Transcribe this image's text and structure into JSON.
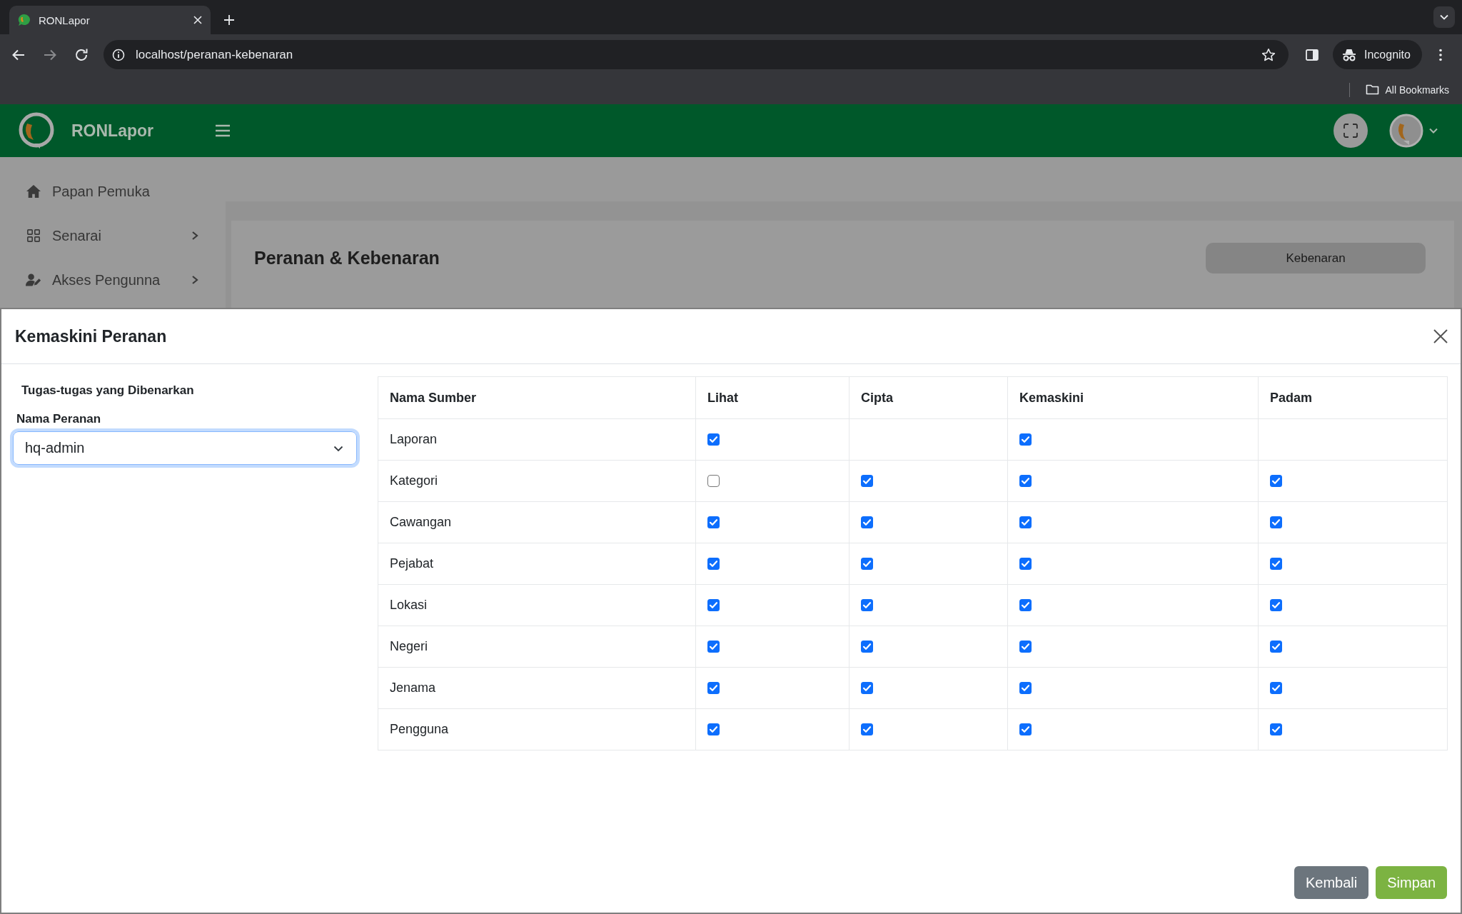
{
  "browser": {
    "tab": {
      "title": "RONLapor"
    },
    "url": "localhost/peranan-kebenaran",
    "profile": {
      "label": "Incognito"
    },
    "bookmarks": [
      "All Bookmarks"
    ]
  },
  "app_header": {
    "brand": "RONLapor"
  },
  "sidebar": {
    "items": [
      {
        "label": "Papan Pemuka",
        "has_submenu": false
      },
      {
        "label": "Senarai",
        "has_submenu": true
      },
      {
        "label": "Akses Pengunna",
        "has_submenu": true
      }
    ]
  },
  "page": {
    "title": "Peranan & Kebenaran",
    "button": "Kebenaran"
  },
  "modal": {
    "title": "Kemaskini Peranan",
    "section_title": "Tugas-tugas yang Dibenarkan",
    "role_field": {
      "label": "Nama Peranan",
      "value": "hq-admin",
      "focused": true
    },
    "table": {
      "columns": [
        "Nama Sumber",
        "Lihat",
        "Cipta",
        "Kemaskini",
        "Padam"
      ],
      "rows": [
        {
          "name": "Laporan",
          "cells": [
            {
              "kind": "checkbox",
              "checked": true
            },
            {
              "kind": "blank"
            },
            {
              "kind": "checkbox",
              "checked": true
            },
            {
              "kind": "blank"
            }
          ]
        },
        {
          "name": "Kategori",
          "cells": [
            {
              "kind": "checkbox",
              "checked": false
            },
            {
              "kind": "checkbox",
              "checked": true
            },
            {
              "kind": "checkbox",
              "checked": true
            },
            {
              "kind": "checkbox",
              "checked": true
            }
          ]
        },
        {
          "name": "Cawangan",
          "cells": [
            {
              "kind": "checkbox",
              "checked": true
            },
            {
              "kind": "checkbox",
              "checked": true
            },
            {
              "kind": "checkbox",
              "checked": true
            },
            {
              "kind": "checkbox",
              "checked": true
            }
          ]
        },
        {
          "name": "Pejabat",
          "cells": [
            {
              "kind": "checkbox",
              "checked": true
            },
            {
              "kind": "checkbox",
              "checked": true
            },
            {
              "kind": "checkbox",
              "checked": true
            },
            {
              "kind": "checkbox",
              "checked": true
            }
          ]
        },
        {
          "name": "Lokasi",
          "cells": [
            {
              "kind": "checkbox",
              "checked": true
            },
            {
              "kind": "checkbox",
              "checked": true
            },
            {
              "kind": "checkbox",
              "checked": true
            },
            {
              "kind": "checkbox",
              "checked": true
            }
          ]
        },
        {
          "name": "Negeri",
          "cells": [
            {
              "kind": "checkbox",
              "checked": true
            },
            {
              "kind": "checkbox",
              "checked": true
            },
            {
              "kind": "checkbox",
              "checked": true
            },
            {
              "kind": "checkbox",
              "checked": true
            }
          ]
        },
        {
          "name": "Jenama",
          "cells": [
            {
              "kind": "checkbox",
              "checked": true
            },
            {
              "kind": "checkbox",
              "checked": true
            },
            {
              "kind": "checkbox",
              "checked": true
            },
            {
              "kind": "checkbox",
              "checked": true
            }
          ]
        },
        {
          "name": "Pengguna",
          "cells": [
            {
              "kind": "checkbox",
              "checked": true
            },
            {
              "kind": "checkbox",
              "checked": true
            },
            {
              "kind": "checkbox",
              "checked": true
            },
            {
              "kind": "checkbox",
              "checked": true
            }
          ]
        }
      ]
    },
    "buttons": [
      {
        "label": "Kembali",
        "kind": "secondary"
      },
      {
        "label": "Simpan",
        "kind": "primary"
      }
    ]
  }
}
